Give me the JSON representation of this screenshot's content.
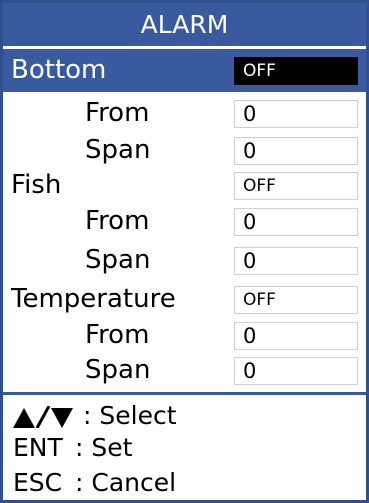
{
  "window": {
    "title": "ALARM"
  },
  "rows": [
    {
      "label": "Bottom",
      "value": "OFF"
    },
    {
      "label": "From",
      "value": "0"
    },
    {
      "label": "Span",
      "value": "0"
    },
    {
      "label": "Fish",
      "value": "OFF"
    },
    {
      "label": "From",
      "value": "0"
    },
    {
      "label": "Span",
      "value": "0"
    },
    {
      "label": "Temperature",
      "value": "OFF"
    },
    {
      "label": "From",
      "value": "0"
    },
    {
      "label": "Span",
      "value": "0"
    }
  ],
  "selected_row": "Bottom",
  "help": [
    {
      "key": "▲/▼",
      "desc": ": Select"
    },
    {
      "key": "ENT",
      "desc": ": Set"
    },
    {
      "key": "ESC",
      "desc": ": Cancel"
    }
  ],
  "colors": {
    "title_bar": "#3a5aa0",
    "highlight": "#3a5aa0",
    "border": "#2f4f8f"
  }
}
